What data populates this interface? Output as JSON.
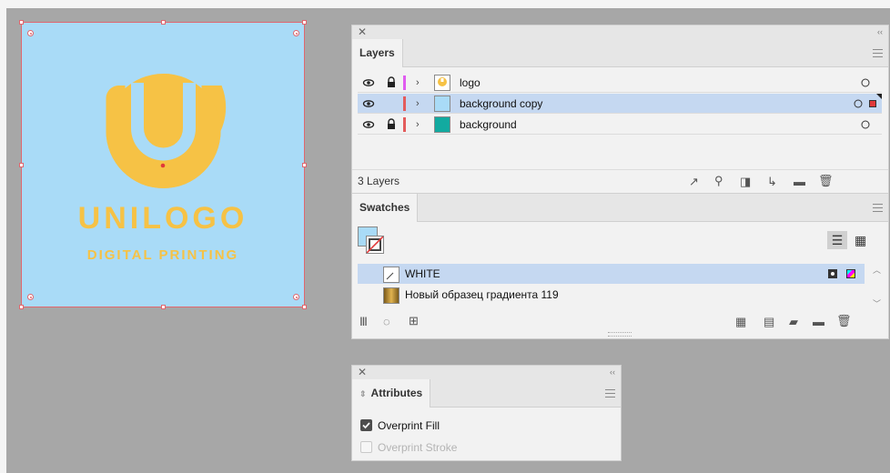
{
  "artboard": {
    "logo_title": "UNILOGO",
    "logo_subtitle": "DIGITAL PRINTING",
    "bg_color": "#a9dbf7",
    "logo_color": "#f6c245"
  },
  "layers_panel": {
    "tab_label": "Layers",
    "layers": [
      {
        "name": "logo",
        "color": "#e05cf0",
        "locked": true,
        "selected": false,
        "thumb": "logo"
      },
      {
        "name": "background copy",
        "color": "#e35c5c",
        "locked": false,
        "selected": true,
        "thumb": "#a9dbf7"
      },
      {
        "name": "background",
        "color": "#e35c5c",
        "locked": true,
        "selected": false,
        "thumb": "#12aaa0"
      }
    ],
    "count_label": "3 Layers"
  },
  "swatches_panel": {
    "tab_label": "Swatches",
    "swatches": [
      {
        "name": "WHITE",
        "selected": true
      },
      {
        "name": "Новый образец градиента 119",
        "selected": false
      }
    ]
  },
  "attributes_panel": {
    "tab_label": "Attributes",
    "overprint_fill": "Overprint Fill",
    "overprint_stroke": "Overprint Stroke",
    "overprint_fill_checked": true,
    "overprint_stroke_checked": false
  }
}
